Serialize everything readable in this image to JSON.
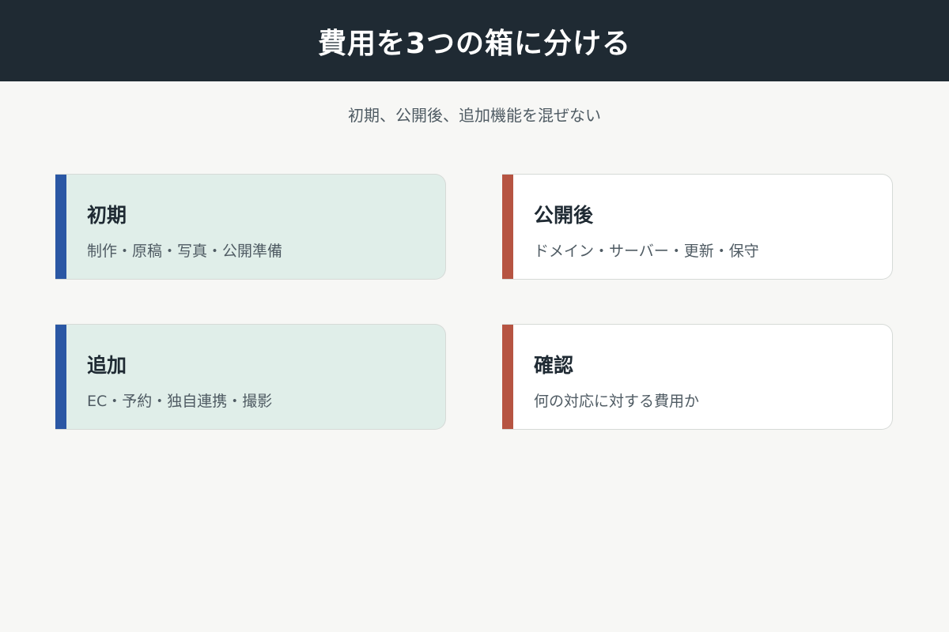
{
  "header": {
    "title": "費用を3つの箱に分ける"
  },
  "subtitle": "初期、公開後、追加機能を混ぜない",
  "colors": {
    "header_bg": "#1f2a33",
    "blue_accent": "#2a57a4",
    "rust_accent": "#b65442",
    "green_card_bg": "#e0eee9",
    "white_card_bg": "#ffffff"
  },
  "cards": [
    {
      "title": "初期",
      "desc": "制作・原稿・写真・公開準備",
      "accent": "blue",
      "background": "green"
    },
    {
      "title": "公開後",
      "desc": "ドメイン・サーバー・更新・保守",
      "accent": "rust",
      "background": "white"
    },
    {
      "title": "追加",
      "desc": "EC・予約・独自連携・撮影",
      "accent": "blue",
      "background": "green"
    },
    {
      "title": "確認",
      "desc": "何の対応に対する費用か",
      "accent": "rust",
      "background": "white"
    }
  ]
}
